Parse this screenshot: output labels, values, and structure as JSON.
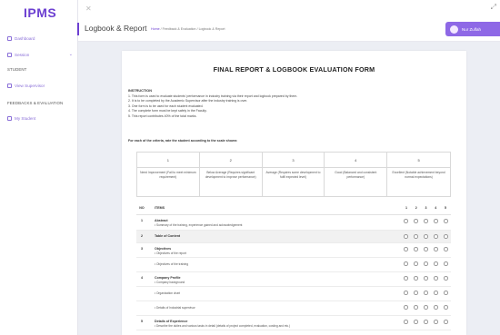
{
  "app": {
    "logo": "IPMS",
    "page_title": "Logbook & Report",
    "breadcrumb": {
      "home": "Home",
      "sep1": "/",
      "parent": "Feedback & Evaluation",
      "sep2": "/",
      "current": "Logbook & Report"
    },
    "user_name": "Nur Zulfah"
  },
  "sidebar": {
    "items": [
      {
        "label": "Dashboard",
        "icon": "home-icon"
      },
      {
        "label": "Session",
        "icon": "calendar-icon",
        "has_chevron": true
      }
    ],
    "sections": [
      {
        "title": "STUDENT",
        "items": [
          {
            "label": "View Supervisor",
            "icon": "user-icon"
          }
        ]
      },
      {
        "title": "FEEDBACKS & EVALUATION",
        "items": [
          {
            "label": "My Student",
            "icon": "users-icon"
          }
        ]
      }
    ]
  },
  "form": {
    "title": "FINAL REPORT & LOGBOOK EVALUATION FORM",
    "instruction_head": "INSTRUCTION",
    "instructions": [
      "1. This form is used to evaluate students' performance in industry training via their report and logbook prepared by them.",
      "2. It is to be completed by the Academic Supervisor after the industry training is over.",
      "3. One form is to be used for each student evaluated.",
      "4. The complete form must be kept safely in the Faculty.",
      "5. This report contributes 40% of the total marks."
    ],
    "rate_lead": "For each of the criteria, rate the student according to the scale shown:",
    "scale": [
      {
        "num": "1",
        "desc": "Need Improvement (Fail to meet minimum requirement)"
      },
      {
        "num": "2",
        "desc": "Below Average (Requires significant development to improve performance)"
      },
      {
        "num": "3",
        "desc": "Average (Requires some development to fulfil expected level)"
      },
      {
        "num": "4",
        "desc": "Good (Balanced and consistent performance)"
      },
      {
        "num": "5",
        "desc": "Excellent (Notable achievement beyond normal expectations)"
      }
    ],
    "items_header": {
      "no": "NO",
      "items": "ITEMS",
      "scores": [
        "1",
        "2",
        "3",
        "4",
        "5"
      ]
    },
    "items": [
      {
        "no": "1",
        "title": "Abstract",
        "sub": "• Summary of the training, experience gained and acknowledgement",
        "shaded": false,
        "radios": true
      },
      {
        "no": "2",
        "title": "Table of Content",
        "sub": "",
        "shaded": true,
        "radios": true
      },
      {
        "no": "3",
        "title": "Objectives",
        "sub": "• Objectives of the report",
        "shaded": false,
        "radios": true
      },
      {
        "no": "",
        "title": "",
        "sub": "• Objectives of the training",
        "shaded": false,
        "radios": true
      },
      {
        "no": "4",
        "title": "Company Profile",
        "sub": "• Company background",
        "shaded": false,
        "radios": true
      },
      {
        "no": "",
        "title": "",
        "sub": "• Organization chart",
        "shaded": false,
        "radios": true
      },
      {
        "no": "",
        "title": "",
        "sub": "• Details of Industrial supervisor",
        "shaded": false,
        "radios": true
      },
      {
        "no": "5",
        "title": "Details of Experience",
        "sub": "• Describe the duties and various tasks in detail (details of project completed, evaluation, costing and etc.)",
        "shaded": false,
        "radios": true
      }
    ]
  }
}
